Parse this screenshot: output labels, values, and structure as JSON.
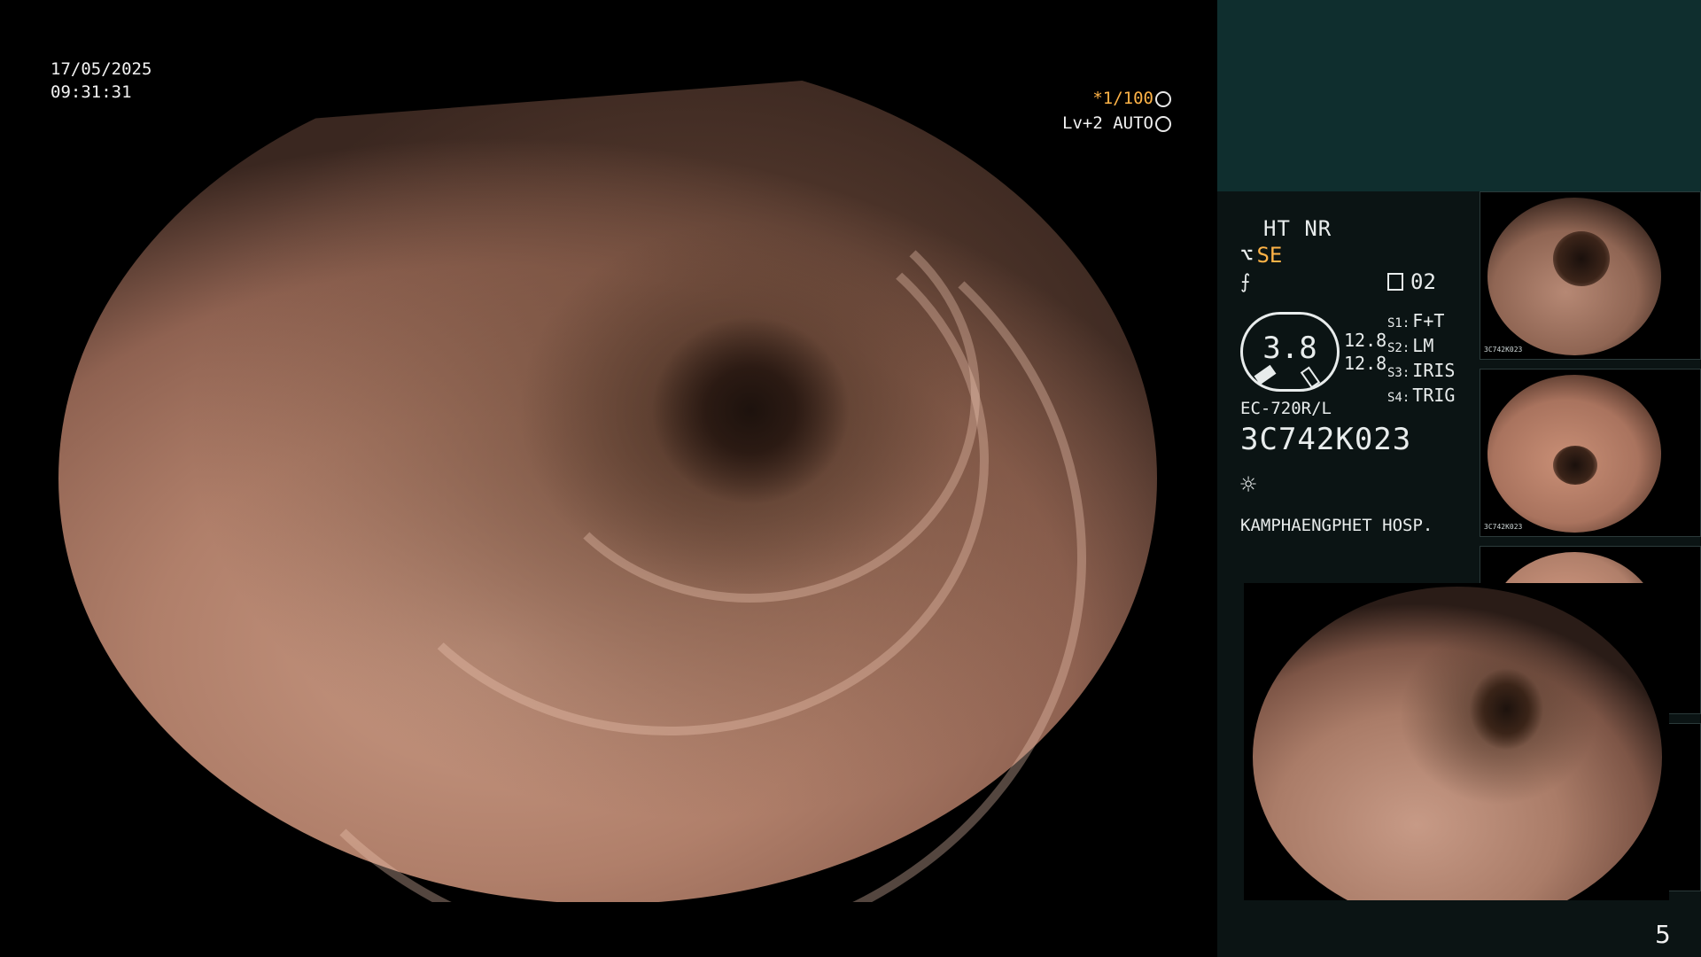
{
  "overlay": {
    "date": "17/05/2025",
    "time": "09:31:31",
    "shutter": "*1/100",
    "level": "Lv+2 AUTO"
  },
  "panel": {
    "mode": "HT NR",
    "se_glyph": "⌥",
    "se": "SE",
    "f_glyph": "⨍",
    "page_count": "02",
    "gauge_value": "3.8",
    "val_a": "12.8",
    "val_b": "12.8",
    "switches": [
      {
        "key": "S1:",
        "value": "F+T"
      },
      {
        "key": "S2:",
        "value": "LM"
      },
      {
        "key": "S3:",
        "value": "IRIS"
      },
      {
        "key": "S4:",
        "value": "TRIG"
      }
    ],
    "model": "EC-720R/L",
    "serial": "3C742K023",
    "light_icon": "☼",
    "hospital": "KAMPHAENGPHET HOSP."
  },
  "thumbnails": [
    {
      "label": "3C742K023",
      "tint": "#b68874"
    },
    {
      "label": "3C742K023",
      "tint": "#c98f76"
    },
    {
      "label": "",
      "tint": "#d49a82"
    }
  ],
  "page_number": "5",
  "icons": {
    "shutter": "aperture-icon",
    "auto": "auto-exposure-icon",
    "memory": "memory-card-icon",
    "light": "light-icon"
  }
}
